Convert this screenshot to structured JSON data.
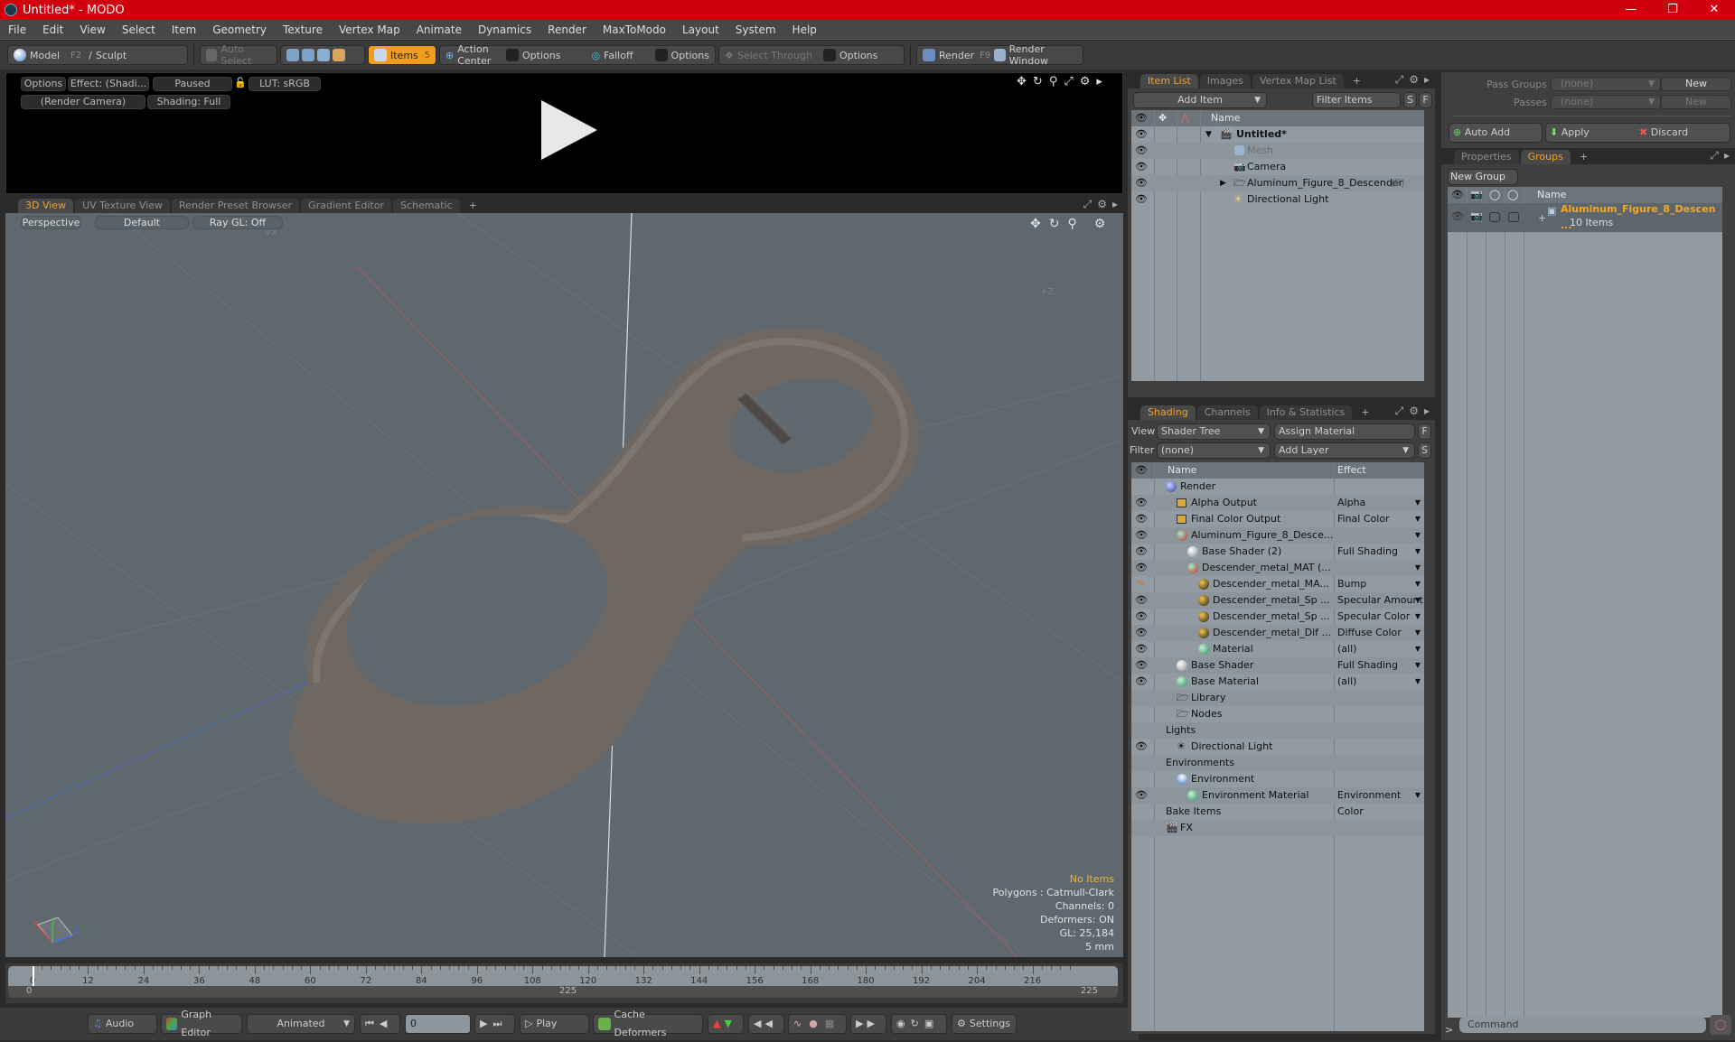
{
  "window": {
    "title": "Untitled* - MODO",
    "controls": [
      "minimize",
      "maximize",
      "close"
    ]
  },
  "menu": [
    "File",
    "Edit",
    "View",
    "Select",
    "Item",
    "Geometry",
    "Texture",
    "Vertex Map",
    "Animate",
    "Dynamics",
    "Render",
    "MaxToModo",
    "Layout",
    "System",
    "Help"
  ],
  "toolbar": {
    "model": "Model",
    "model_key": "F2",
    "sculpt": "Sculpt",
    "auto_select": "Auto Select",
    "items": "Items",
    "items_key": "5",
    "action_center": "Action Center",
    "options1": "Options",
    "falloff": "Falloff",
    "options2": "Options",
    "select_through": "Select Through",
    "options3": "Options",
    "render": "Render",
    "render_key": "F9",
    "render_window": "Render Window"
  },
  "preview": {
    "options": "Options",
    "effect": "Effect: (Shadi...",
    "paused": "Paused",
    "lut": "LUT: sRGB",
    "camera": "(Render Camera)",
    "shading": "Shading: Full"
  },
  "viewport_tabs": [
    "3D View",
    "UV Texture View",
    "Render Preset Browser",
    "Gradient Editor",
    "Schematic"
  ],
  "viewport": {
    "perspective": "Perspective",
    "default": "Default",
    "raygl": "Ray GL: Off",
    "axis_x": "+X",
    "axis_z": "+Z",
    "stats": {
      "items": "No Items",
      "polygons": "Polygons : Catmull-Clark",
      "channels": "Channels: 0",
      "deformers": "Deformers: ON",
      "gl": "GL: 25,184",
      "grid": "5 mm"
    },
    "gizmo": {
      "x": "X",
      "y": "Y",
      "z": "Z"
    }
  },
  "timeline": {
    "ticks": [
      "0",
      "12",
      "24",
      "36",
      "48",
      "60",
      "72",
      "84",
      "96",
      "108",
      "120",
      "132",
      "144",
      "156",
      "168",
      "180",
      "192",
      "204",
      "216"
    ],
    "range_start": "0",
    "range_mid": "225",
    "range_end": "225"
  },
  "bottombar": {
    "audio": "Audio",
    "graph_editor": "Graph Editor",
    "animated": "Animated",
    "frame": "0",
    "play": "Play",
    "cache_deformers": "Cache Deformers",
    "settings": "Settings"
  },
  "itemlist": {
    "tabs": [
      "Item List",
      "Images",
      "Vertex Map List"
    ],
    "add_item": "Add Item",
    "filter": "Filter Items",
    "s": "S",
    "f": "F",
    "col_name": "Name",
    "rows": [
      {
        "name": "Untitled*",
        "bold": true
      },
      {
        "name": "Mesh",
        "dim": true
      },
      {
        "name": "Camera"
      },
      {
        "name": "Aluminum_Figure_8_Descender",
        "count": "(2)"
      },
      {
        "name": "Directional Light"
      }
    ]
  },
  "shading": {
    "tabs": [
      "Shading",
      "Channels",
      "Info & Statistics"
    ],
    "view_label": "View",
    "view_value": "Shader Tree",
    "assign_material": "Assign Material",
    "filter_label": "Filter",
    "filter_value": "(none)",
    "add_layer": "Add Layer",
    "f": "F",
    "s": "S",
    "col_name": "Name",
    "col_effect": "Effect",
    "rows": [
      {
        "name": "Render",
        "effect": "",
        "indent": 0
      },
      {
        "name": "Alpha Output",
        "effect": "Alpha",
        "indent": 1
      },
      {
        "name": "Final Color Output",
        "effect": "Final Color",
        "indent": 1
      },
      {
        "name": "Aluminum_Figure_8_Desce...",
        "effect": "",
        "indent": 1
      },
      {
        "name": "Base Shader (2)",
        "effect": "Full Shading",
        "indent": 2
      },
      {
        "name": "Descender_metal_MAT (...",
        "effect": "",
        "indent": 2
      },
      {
        "name": "Descender_metal_MA...",
        "effect": "Bump",
        "indent": 3
      },
      {
        "name": "Descender_metal_Sp ...",
        "effect": "Specular Amount",
        "indent": 3
      },
      {
        "name": "Descender_metal_Sp ...",
        "effect": "Specular Color",
        "indent": 3
      },
      {
        "name": "Descender_metal_Dif ...",
        "effect": "Diffuse Color",
        "indent": 3
      },
      {
        "name": "Material",
        "effect": "(all)",
        "indent": 3
      },
      {
        "name": "Base Shader",
        "effect": "Full Shading",
        "indent": 1
      },
      {
        "name": "Base Material",
        "effect": "(all)",
        "indent": 1
      },
      {
        "name": "Library",
        "effect": "",
        "indent": 1
      },
      {
        "name": "Nodes",
        "effect": "",
        "indent": 1
      },
      {
        "name": "Lights",
        "effect": "",
        "indent": 0
      },
      {
        "name": "Directional Light",
        "effect": "",
        "indent": 1
      },
      {
        "name": "Environments",
        "effect": "",
        "indent": 0
      },
      {
        "name": "Environment",
        "effect": "",
        "indent": 1
      },
      {
        "name": "Environment Material",
        "effect": "Environment Color",
        "indent": 2
      },
      {
        "name": "Bake Items",
        "effect": "",
        "indent": 0
      },
      {
        "name": "FX",
        "effect": "",
        "indent": 0
      }
    ]
  },
  "passes": {
    "pass_groups_label": "Pass Groups",
    "pass_groups_value": "(none)",
    "new1": "New",
    "passes_label": "Passes",
    "passes_value": "(none)",
    "new2": "New",
    "auto_add": "Auto Add",
    "apply": "Apply",
    "discard": "Discard"
  },
  "groups": {
    "tabs": [
      "Properties",
      "Groups"
    ],
    "new_group": "New Group",
    "col_name": "Name",
    "group_name": "Aluminum_Figure_8_Descen ...",
    "group_count": "10 Items"
  },
  "command": {
    "placeholder": "Command",
    "prompt": ">"
  }
}
